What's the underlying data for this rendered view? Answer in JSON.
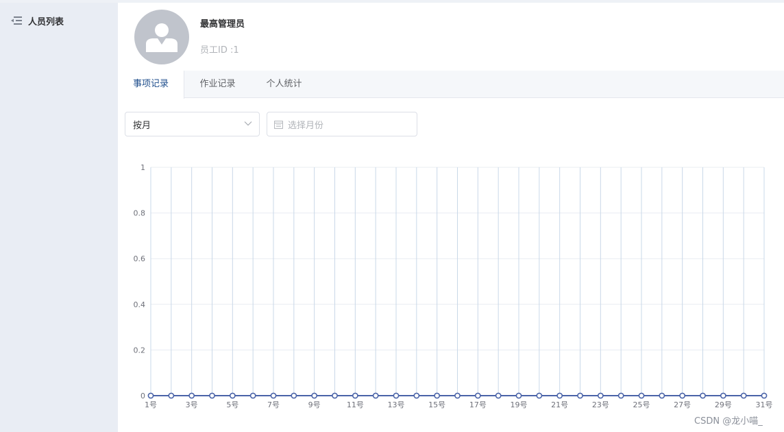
{
  "sidebar": {
    "items": [
      {
        "label": "人员列表",
        "icon": "menu-fold-icon"
      }
    ]
  },
  "profile": {
    "name": "最高管理员",
    "id_text": "员工ID :1",
    "avatar_icon": "user-avatar-icon"
  },
  "tabs": [
    {
      "label": "事项记录",
      "active": true
    },
    {
      "label": "作业记录",
      "active": false
    },
    {
      "label": "个人统计",
      "active": false
    }
  ],
  "filters": {
    "mode_value": "按月",
    "month_placeholder": "选择月份"
  },
  "colors": {
    "accent": "#1f4e8c",
    "series": "#4a63a8",
    "grid_vertical": "#c9d8e8",
    "grid_horizontal": "#e8ecf2"
  },
  "chart_data": {
    "type": "line",
    "x": [
      "1号",
      "2号",
      "3号",
      "4号",
      "5号",
      "6号",
      "7号",
      "8号",
      "9号",
      "10号",
      "11号",
      "12号",
      "13号",
      "14号",
      "15号",
      "16号",
      "17号",
      "18号",
      "19号",
      "20号",
      "21号",
      "22号",
      "23号",
      "24号",
      "25号",
      "26号",
      "27号",
      "28号",
      "29号",
      "30号",
      "31号"
    ],
    "x_tick_labels": [
      "1号",
      "3号",
      "5号",
      "7号",
      "9号",
      "11号",
      "13号",
      "15号",
      "17号",
      "19号",
      "21号",
      "23号",
      "25号",
      "27号",
      "29号",
      "31号"
    ],
    "y_tick_labels": [
      "0",
      "0.2",
      "0.4",
      "0.6",
      "0.8",
      "1"
    ],
    "series": [
      {
        "values": [
          0,
          0,
          0,
          0,
          0,
          0,
          0,
          0,
          0,
          0,
          0,
          0,
          0,
          0,
          0,
          0,
          0,
          0,
          0,
          0,
          0,
          0,
          0,
          0,
          0,
          0,
          0,
          0,
          0,
          0,
          0
        ]
      }
    ],
    "ylim": [
      0,
      1
    ],
    "grid": true,
    "legend": "none"
  },
  "watermark": "CSDN @龙小喵_"
}
